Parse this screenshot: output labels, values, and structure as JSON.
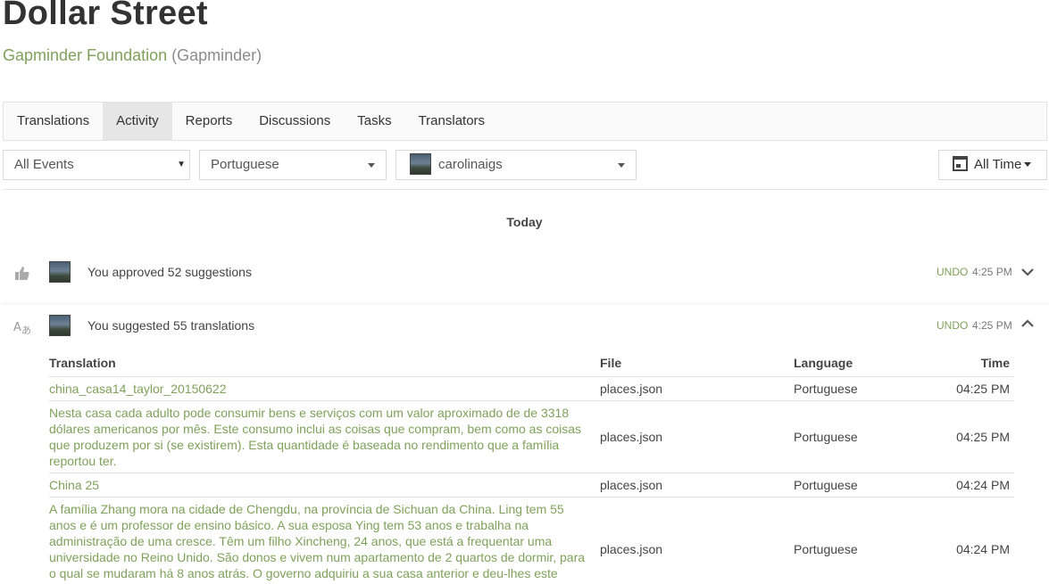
{
  "project": {
    "title": "Dollar Street",
    "org": "Gapminder Foundation",
    "org_slug": "(Gapminder)"
  },
  "tabs": [
    {
      "label": "Translations"
    },
    {
      "label": "Activity",
      "active": true
    },
    {
      "label": "Reports"
    },
    {
      "label": "Discussions"
    },
    {
      "label": "Tasks"
    },
    {
      "label": "Translators"
    }
  ],
  "filters": {
    "events": "All Events",
    "language": "Portuguese",
    "user": "carolinaigs",
    "time": "All Time"
  },
  "day_label": "Today",
  "events": [
    {
      "icon": "thumbs-up-icon",
      "text": "You approved 52 suggestions",
      "undo": "UNDO",
      "time": "4:25 PM",
      "expanded": false
    },
    {
      "icon": "translate-icon",
      "text": "You suggested 55 translations",
      "undo": "UNDO",
      "time": "4:25 PM",
      "expanded": true
    }
  ],
  "table": {
    "headers": {
      "translation": "Translation",
      "file": "File",
      "language": "Language",
      "time": "Time"
    },
    "rows": [
      {
        "translation": "china_casa14_taylor_20150622",
        "file": "places.json",
        "language": "Portuguese",
        "time": "04:25 PM"
      },
      {
        "translation": "Nesta casa cada adulto pode consumir bens e serviços com um valor aproximado de de 3318 dólares americanos por mês. Este consumo inclui as coisas que compram, bem como as coisas que produzem por si (se existirem). Esta quantidade é baseada no rendimento que a família reportou ter.",
        "file": "places.json",
        "language": "Portuguese",
        "time": "04:25 PM"
      },
      {
        "translation": "China 25",
        "file": "places.json",
        "language": "Portuguese",
        "time": "04:24 PM"
      },
      {
        "translation": "A família Zhang mora na cidade de Chengdu, na província de Sichuan da China. Ling tem 55 anos e é um professor de ensino básico. A sua esposa Ying tem 53 anos e trabalha na administração de uma cresce. Têm um filho Xincheng, 24 anos, que está a frequentar uma universidade no Reino Unido. São donos e vivem num apartamento de 2 quartos de dormir, para o qual se mudaram há 8 anos atrás. O governo adquiriu a sua casa anterior e deu-lhes este apartamento em troca. Fica perto do",
        "file": "places.json",
        "language": "Portuguese",
        "time": "04:24 PM"
      }
    ]
  },
  "colors": {
    "accent": "#7fa15b",
    "tab_active": "#e6e6e6"
  }
}
